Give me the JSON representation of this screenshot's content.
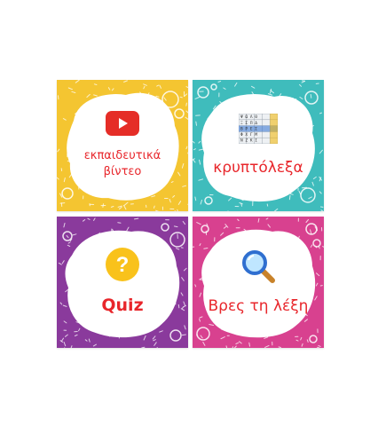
{
  "tiles": [
    {
      "id": "videos",
      "label": "εκπαιδευτικά βίντεο",
      "bg_color": "#f4c531",
      "speck_color": "#ffffff",
      "icon": "youtube-play-icon"
    },
    {
      "id": "crossword",
      "label": "κρυπτόλεξα",
      "bg_color": "#3fbcbc",
      "speck_color": "#ffffff",
      "icon": "crossword-grid-icon"
    },
    {
      "id": "quiz",
      "label": "Quiz",
      "bg_color": "#8a3a9c",
      "speck_color": "#ffffff",
      "icon": "question-mark-icon"
    },
    {
      "id": "find-word",
      "label": "Βρες τη λέξη",
      "bg_color": "#d8418f",
      "speck_color": "#ffffff",
      "icon": "magnifier-icon"
    }
  ],
  "colors": {
    "label_red": "#e8262b",
    "youtube_red": "#e52d27",
    "quiz_yellow": "#f9c21b"
  }
}
